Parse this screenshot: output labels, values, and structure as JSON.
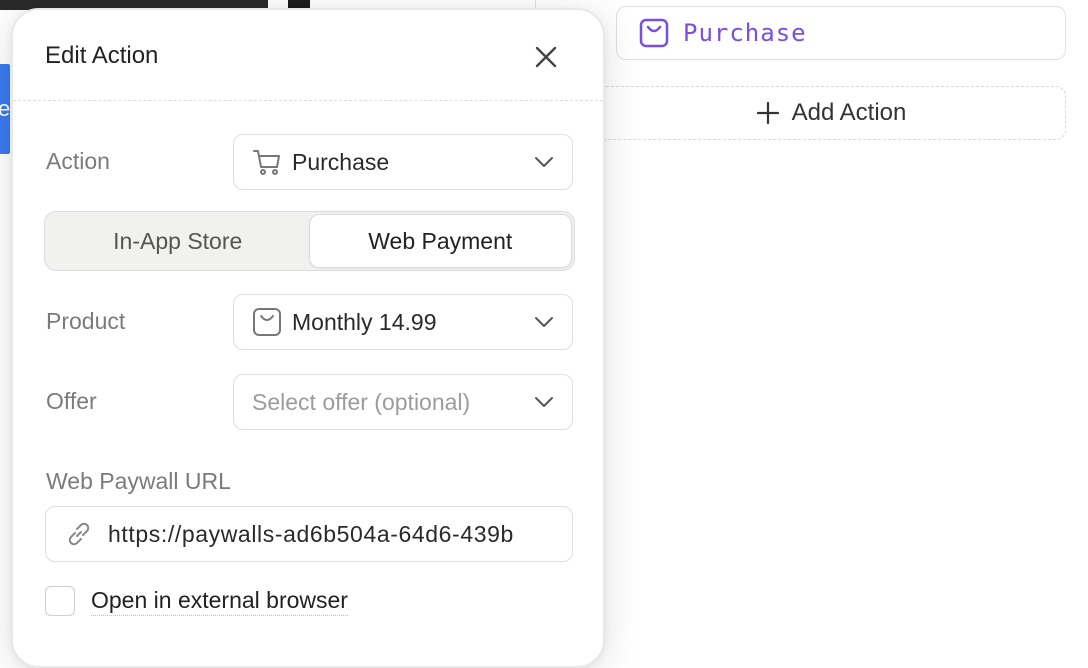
{
  "background": {
    "purchase_chip": {
      "label": "Purchase",
      "icon": "bag-icon",
      "color": "#7a4fe0"
    },
    "add_action": {
      "label": "Add Action",
      "icon": "plus-icon"
    },
    "blue_fragment_text": "e"
  },
  "modal": {
    "title": "Edit Action",
    "close_icon": "close-icon",
    "action": {
      "label": "Action",
      "value": "Purchase",
      "icon": "cart-icon"
    },
    "store_toggle": {
      "options": [
        "In-App Store",
        "Web Payment"
      ],
      "selected": "Web Payment"
    },
    "product": {
      "label": "Product",
      "value": "Monthly 14.99",
      "icon": "bag-icon"
    },
    "offer": {
      "label": "Offer",
      "placeholder": "Select offer (optional)"
    },
    "web_paywall_url": {
      "label": "Web Paywall URL",
      "value": "https://paywalls-ad6b504a-64d6-439b",
      "icon": "link-icon"
    },
    "external_browser": {
      "label": "Open in external browser",
      "checked": false
    }
  }
}
